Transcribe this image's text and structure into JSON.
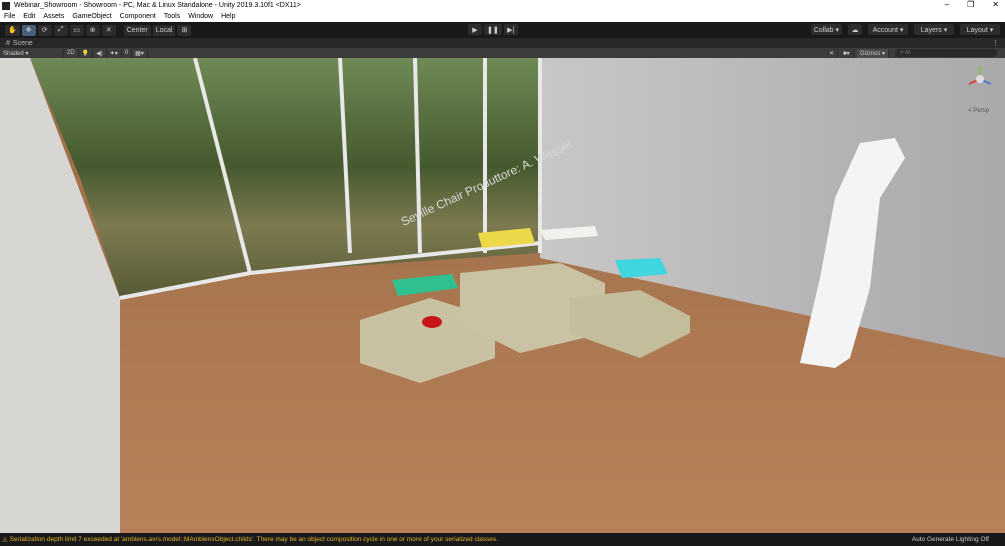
{
  "window": {
    "title": "Webinar_Showroom - Showroom - PC, Mac & Linux Standalone - Unity 2019.3.10f1 <DX11>",
    "controls": [
      "–",
      "❐",
      "✕"
    ]
  },
  "menu": [
    "File",
    "Edit",
    "Assets",
    "GameObject",
    "Component",
    "Tools",
    "Window",
    "Help"
  ],
  "toolbar": {
    "tools": [
      "✋",
      "✥",
      "⟳",
      "⤢",
      "▭",
      "⊕",
      "✕"
    ],
    "pivot": "Center",
    "space": "Local",
    "play": [
      "▶",
      "❚❚",
      "▶|"
    ],
    "collab": "Collab ▾",
    "account": "Account ▾",
    "layers": "Layers ▾",
    "layout": "Layout ▾"
  },
  "scene_tab": {
    "label": "Scene"
  },
  "scene_toolbar": {
    "shading": "Shaded ▾",
    "mode_2d": "2D",
    "hidden": "0",
    "gizmos": "Gizmos ▾",
    "search_placeholder": "All",
    "gizmo_label": "< Persp"
  },
  "viewport": {
    "sign_text": "Seville Chair Produttore: A. Wessel"
  },
  "status": {
    "message": "Serialization depth limit 7 exceeded at 'ambiens.avrs.model::MAmbiensObject.childs'. There may be an object composition cycle in one or more of your serialized classes.",
    "right": "Auto Generate Lighting Off"
  }
}
